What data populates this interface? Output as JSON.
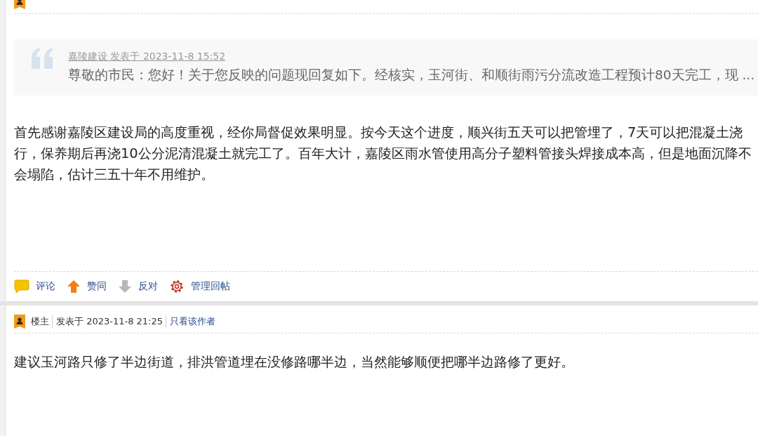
{
  "posts": [
    {
      "quote": {
        "source": "嘉陵建设 发表于 2023-11-8 15:52",
        "text": "尊敬的市民：您好！关于您反映的问题现回复如下。经核实，玉河街、和顺街雨污分流改造工程预计80天完工，现 ..."
      },
      "body": [
        "首先感谢嘉陵区建设局的高度重视，经你局督促效果明显。按今天这个进度，顺兴街五天可以把管埋了，7天可以把混凝土浇",
        "行，保养期后再浇10公分泥清混凝土就完工了。百年大计，嘉陵区雨水管使用高分子塑料管接头焊接成本高，但是地面沉降不",
        "会塌陷，估计三五十年不用维护。"
      ],
      "actions": [
        {
          "kind": "comment",
          "label": "评论"
        },
        {
          "kind": "up",
          "label": "赞同"
        },
        {
          "kind": "down",
          "label": "反对"
        },
        {
          "kind": "manage",
          "label": "管理回帖"
        }
      ]
    },
    {
      "header": {
        "role": "楼主",
        "posted": "发表于 2023-11-8 21:25",
        "author_link": "只看该作者"
      },
      "body": [
        "建议玉河路只修了半边街道，排洪管道埋在没修路哪半边，当然能够顺便把哪半边路修了更好。"
      ]
    }
  ]
}
